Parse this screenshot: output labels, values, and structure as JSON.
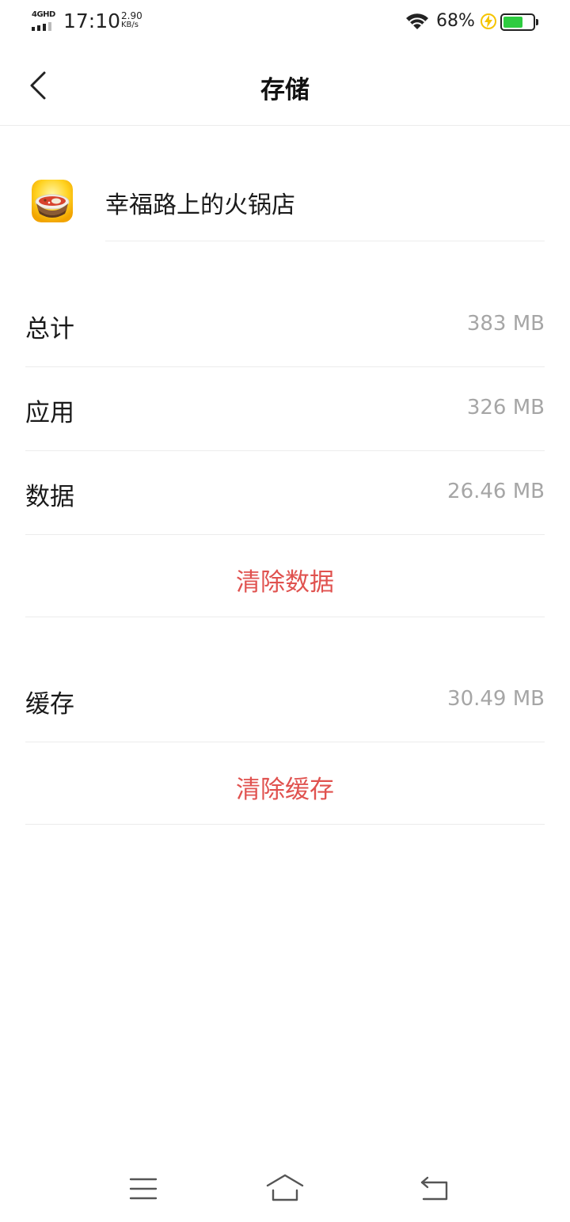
{
  "status_bar": {
    "network": "4GHD",
    "time": "17:10",
    "speed_value": "2.90",
    "speed_unit": "KB/s",
    "battery_percent": "68%",
    "battery_level": 0.68,
    "charging": true,
    "battery_color": "#2ecc40"
  },
  "header": {
    "back_icon": "chevron-left-icon",
    "title": "存储"
  },
  "app": {
    "icon": "hotpot-app-icon",
    "name": "幸福路上的火锅店"
  },
  "storage": {
    "rows": [
      {
        "label": "总计",
        "value": "383 MB"
      },
      {
        "label": "应用",
        "value": "326 MB"
      },
      {
        "label": "数据",
        "value": "26.46 MB"
      }
    ],
    "clear_data_label": "清除数据",
    "cache": {
      "label": "缓存",
      "value": "30.49 MB"
    },
    "clear_cache_label": "清除缓存"
  },
  "nav_bar": {
    "menu_icon": "menu-icon",
    "home_icon": "home-icon",
    "back_icon": "back-icon"
  },
  "colors": {
    "accent_red": "#e0524f",
    "value_gray": "#a6a6a6",
    "divider": "#ececec"
  }
}
